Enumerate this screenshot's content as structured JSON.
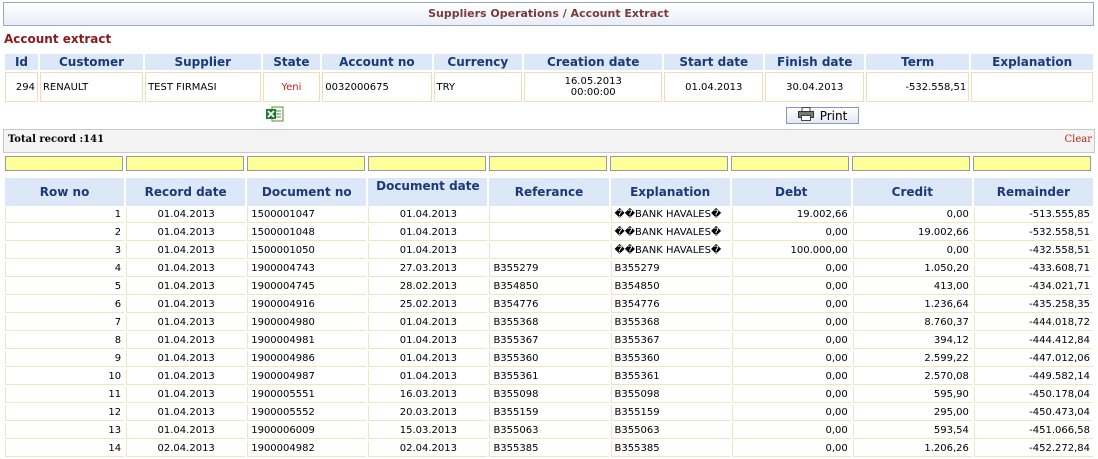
{
  "title": "Suppliers Operations / Account Extract",
  "section_title": "Account extract",
  "account_headers": [
    "Id",
    "Customer",
    "Supplier",
    "State",
    "Account no",
    "Currency",
    "Creation date",
    "Start date",
    "Finish date",
    "Term",
    "Explanation"
  ],
  "account": {
    "id": "294",
    "customer": "RENAULT",
    "supplier": "TEST FIRMASI",
    "state": "Yeni",
    "account_no": "0032000675",
    "currency": "TRY",
    "creation_date": "16.05.2013",
    "creation_time": "00:00:00",
    "start_date": "01.04.2013",
    "finish_date": "30.04.2013",
    "term": "-532.558,51",
    "explanation": ""
  },
  "icons": {
    "excel": "excel-export-icon",
    "print": "printer-icon"
  },
  "print_label": "Print",
  "total_record": "Total record :141",
  "clear_label": "Clear",
  "columns": [
    "Row no",
    "Record date",
    "Document no",
    "Document date",
    "Referance",
    "Explanation",
    "Debt",
    "Credit",
    "Remainder"
  ],
  "rows": [
    [
      "1",
      "01.04.2013",
      "1500001047",
      "01.04.2013",
      "",
      "��BANK HAVALES�",
      "19.002,66",
      "0,00",
      "-513.555,85"
    ],
    [
      "2",
      "01.04.2013",
      "1500001048",
      "01.04.2013",
      "",
      "��BANK HAVALES�",
      "0,00",
      "19.002,66",
      "-532.558,51"
    ],
    [
      "3",
      "01.04.2013",
      "1500001050",
      "01.04.2013",
      "",
      "��BANK HAVALES�",
      "100.000,00",
      "0,00",
      "-432.558,51"
    ],
    [
      "4",
      "01.04.2013",
      "1900004743",
      "27.03.2013",
      "B355279",
      "B355279",
      "0,00",
      "1.050,20",
      "-433.608,71"
    ],
    [
      "5",
      "01.04.2013",
      "1900004745",
      "28.02.2013",
      "B354850",
      "B354850",
      "0,00",
      "413,00",
      "-434.021,71"
    ],
    [
      "6",
      "01.04.2013",
      "1900004916",
      "25.02.2013",
      "B354776",
      "B354776",
      "0,00",
      "1.236,64",
      "-435.258,35"
    ],
    [
      "7",
      "01.04.2013",
      "1900004980",
      "01.04.2013",
      "B355368",
      "B355368",
      "0,00",
      "8.760,37",
      "-444.018,72"
    ],
    [
      "8",
      "01.04.2013",
      "1900004981",
      "01.04.2013",
      "B355367",
      "B355367",
      "0,00",
      "394,12",
      "-444.412,84"
    ],
    [
      "9",
      "01.04.2013",
      "1900004986",
      "01.04.2013",
      "B355360",
      "B355360",
      "0,00",
      "2.599,22",
      "-447.012,06"
    ],
    [
      "10",
      "01.04.2013",
      "1900004987",
      "01.04.2013",
      "B355361",
      "B355361",
      "0,00",
      "2.570,08",
      "-449.582,14"
    ],
    [
      "11",
      "01.04.2013",
      "1900005551",
      "16.03.2013",
      "B355098",
      "B355098",
      "0,00",
      "595,90",
      "-450.178,04"
    ],
    [
      "12",
      "01.04.2013",
      "1900005552",
      "20.03.2013",
      "B355159",
      "B355159",
      "0,00",
      "295,00",
      "-450.473,04"
    ],
    [
      "13",
      "01.04.2013",
      "1900006009",
      "15.03.2013",
      "B355063",
      "B355063",
      "0,00",
      "593,54",
      "-451.066,58"
    ],
    [
      "14",
      "02.04.2013",
      "1900004982",
      "02.04.2013",
      "B355385",
      "B355385",
      "0,00",
      "1.206,26",
      "-452.272,84"
    ]
  ]
}
